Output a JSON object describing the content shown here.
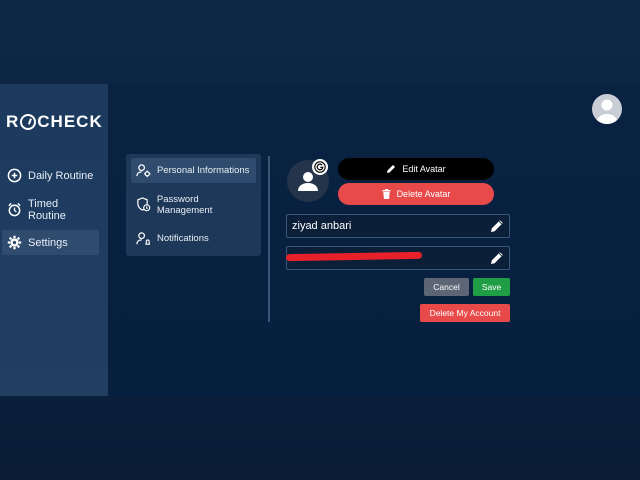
{
  "app": {
    "logo_left": "R",
    "logo_right": "CHECK"
  },
  "sidebar": {
    "items": [
      {
        "label": "Daily Routine",
        "icon": "plus-circle-icon"
      },
      {
        "label": "Timed Routine",
        "icon": "alarm-clock-icon"
      },
      {
        "label": "Settings",
        "icon": "gear-icon",
        "active": true
      }
    ]
  },
  "settings_menu": {
    "items": [
      {
        "label": "Personal Informations",
        "icon": "user-gear-icon",
        "active": true
      },
      {
        "label": "Password Management",
        "icon": "shield-lock-icon"
      },
      {
        "label": "Notifications",
        "icon": "user-bell-icon"
      }
    ]
  },
  "profile": {
    "edit_avatar_label": "Edit Avatar",
    "delete_avatar_label": "Delete Avatar",
    "name_value": "ziyad anbari",
    "email_value": "",
    "cancel_label": "Cancel",
    "save_label": "Save",
    "delete_account_label": "Delete My Account"
  },
  "colors": {
    "accent_red": "#e84a4a",
    "save_green": "#1f9e45",
    "cancel_gray": "#5c6675",
    "sidebar_bg": "#1c3a5e",
    "app_bg": "#092241"
  }
}
